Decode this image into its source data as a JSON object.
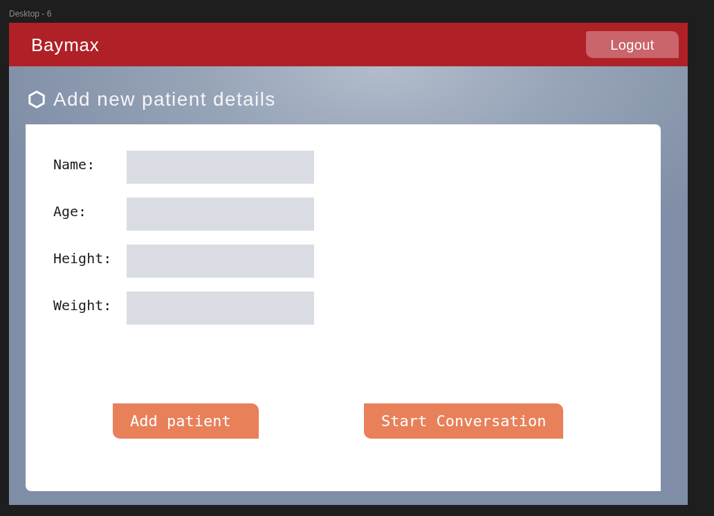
{
  "canvas": {
    "frame_label": "Desktop - 6"
  },
  "header": {
    "brand": "Baymax",
    "logout_button": "Logout"
  },
  "page": {
    "title": "Add new patient details"
  },
  "form": {
    "fields": [
      {
        "label": "Name:"
      },
      {
        "label": "Age:"
      },
      {
        "label": "Height:"
      },
      {
        "label": "Weight:"
      }
    ]
  },
  "buttons": [
    {
      "label": "Add patient"
    },
    {
      "label": "Start Conversation"
    }
  ]
}
